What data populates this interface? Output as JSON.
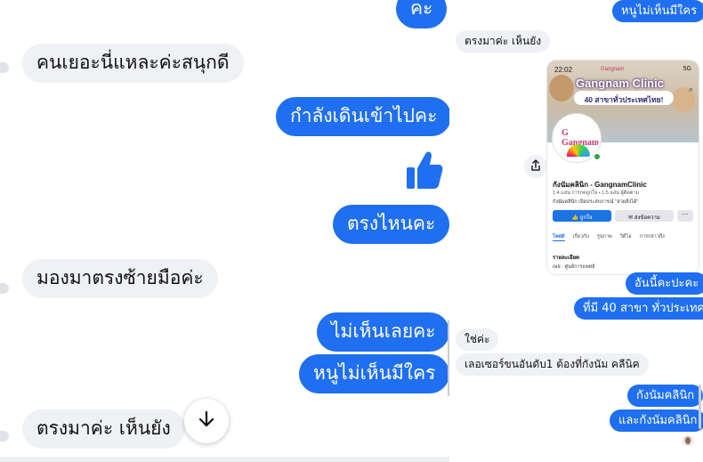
{
  "left_chat": {
    "messages": [
      {
        "side": "out",
        "text": "คะ"
      },
      {
        "side": "in",
        "text": "คนเยอะนี่แหละค่ะสนุกดี"
      },
      {
        "side": "out",
        "text": "กำลังเดินเข้าไปคะ"
      },
      {
        "side": "out",
        "text": "ตรงไหนคะ"
      },
      {
        "side": "in",
        "text": "มองมาตรงซ้ายมือค่ะ"
      },
      {
        "side": "out",
        "text": "ไม่เห็นเลยคะ"
      },
      {
        "side": "out",
        "text": "หนูไม่เห็นมีใคร"
      },
      {
        "side": "in",
        "text": "ตรงมาค่ะ เห็นยัง"
      }
    ],
    "reaction": "thumbs-up-icon",
    "scroll_down_icon": "arrow-down-icon"
  },
  "right_chat": {
    "messages": [
      {
        "side": "out",
        "text": "หนูไม่เห็นมีใคร"
      },
      {
        "side": "in",
        "text": "ตรงมาค่ะ เห็นยัง"
      },
      {
        "side": "out",
        "text": "อันนี้คะปะคะ"
      },
      {
        "side": "out",
        "text": "ที่มี 40 สาขา ทั่วประเทศ"
      },
      {
        "side": "in",
        "text": "ใช่ค่ะ"
      },
      {
        "side": "in",
        "text": "เลอเซอร์ขนอันดับ1 ต้องที่กังนัม คลีนิค"
      },
      {
        "side": "out",
        "text": "กังนัมคลินิก"
      },
      {
        "side": "out",
        "text": "และกังนัมคลินิก"
      }
    ],
    "shared_page": {
      "status_time": "22:02",
      "status_signal": "5G",
      "brand_small": "Gangnam",
      "banner_title": "Gangnam Clinic",
      "banner_sub": "40 สาขาทั่วประเทศไทย!",
      "logo_text": "G Gangnam",
      "page_name": "กังนัมคลินิก - GangnamClinic",
      "stats": "1.4 แสน การกดถูกใจ  •  1.5 แสน ผู้ติดตาม",
      "description": "กังนัมคลินิก เปิดประสบการณ์ \"สวยสั่งได้\"",
      "like_label": "ถูกใจ",
      "message_label": "ส่งข้อความ",
      "more_label": "···",
      "tabs": [
        "โพสต์",
        "เกี่ยวกับ",
        "รูปภาพ",
        "วิดีโอ",
        "การกล่าวถึง"
      ],
      "details_heading": "รายละเอียด",
      "details_line": "เพจ · ศูนย์การแพทย์"
    }
  },
  "colors": {
    "outgoing": "#1f6ff0",
    "incoming": "#eff1f4",
    "facebook_blue": "#1b74e4"
  }
}
